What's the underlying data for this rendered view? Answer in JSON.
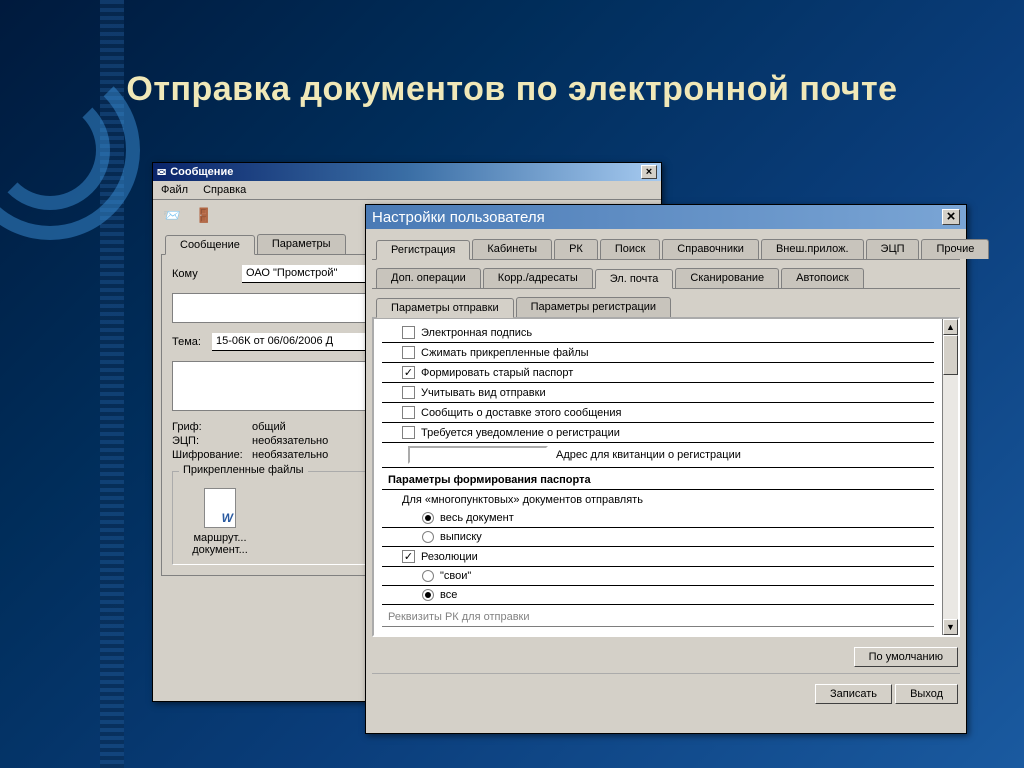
{
  "slide": {
    "title": "Отправка документов по электронной почте"
  },
  "win1": {
    "title": "Сообщение",
    "menu": {
      "file": "Файл",
      "help": "Справка"
    },
    "tabs": {
      "message": "Сообщение",
      "params": "Параметры"
    },
    "to_label": "Кому",
    "to_value": "ОАО \"Промстрой\"",
    "subject_label": "Тема:",
    "subject_value": "15-06К от 06/06/2006 Д",
    "grif_label": "Гриф:",
    "grif_value": "общий",
    "ecp_label": "ЭЦП:",
    "ecp_value": "необязательно",
    "enc_label": "Шифрование:",
    "enc_value": "необязательно",
    "attach_label": "Прикрепленные файлы",
    "file1": "маршрут...",
    "file2": "документ..."
  },
  "win2": {
    "title": "Настройки пользователя",
    "tabs1": {
      "reg": "Регистрация",
      "kab": "Кабинеты",
      "rk": "РК",
      "search": "Поиск",
      "sprav": "Справочники",
      "ext": "Внеш.прилож.",
      "ecp": "ЭЦП",
      "other": "Прочие"
    },
    "tabs2": {
      "dop": "Доп. операции",
      "korr": "Корр./адресаты",
      "email": "Эл. почта",
      "scan": "Сканирование",
      "auto": "Автопоиск"
    },
    "tabs3": {
      "send": "Параметры отправки",
      "reg": "Параметры регистрации"
    },
    "checks": {
      "c1": "Электронная подпись",
      "c2": "Сжимать прикрепленные файлы",
      "c3": "Формировать старый паспорт",
      "c4": "Учитывать вид отправки",
      "c5": "Сообщить о доставке этого сообщения",
      "c6": "Требуется уведомление о регистрации"
    },
    "addr_label": "Адрес для квитанции о регистрации",
    "section_hdr": "Параметры формирования паспорта",
    "multi_label": "Для «многопунктовых» документов отправлять",
    "r1": "весь документ",
    "r2": "выписку",
    "res_check": "Резолюции",
    "r3": "\"свои\"",
    "r4": "все",
    "cut_text": "Реквизиты РК для отправки",
    "btn_default": "По умолчанию",
    "btn_save": "Записать",
    "btn_exit": "Выход"
  }
}
